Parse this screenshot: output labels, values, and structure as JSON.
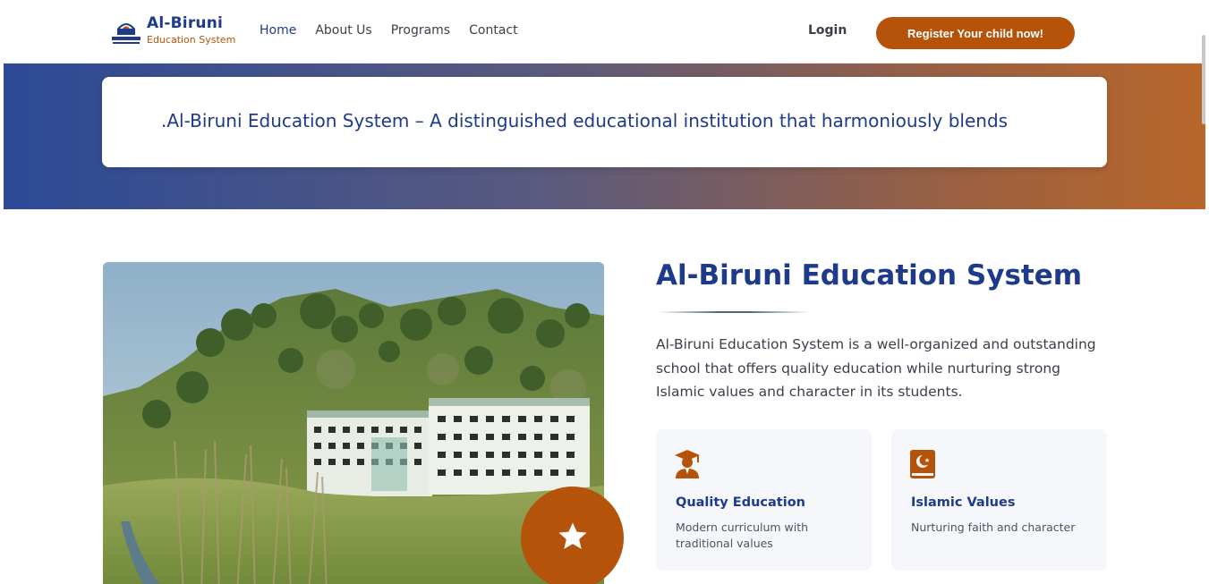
{
  "header": {
    "brand_title": "Al-Biruni",
    "brand_subtitle": "Education System",
    "nav": [
      {
        "label": "Home"
      },
      {
        "label": "About Us"
      },
      {
        "label": "Programs"
      },
      {
        "label": "Contact"
      }
    ],
    "login_label": "Login",
    "register_label": "Register Your child now!"
  },
  "banner": {
    "ticker_text": ".Al-Biruni Education System – A distinguished educational institution that harmoniously blends"
  },
  "about": {
    "title": "Al-Biruni Education System",
    "description": "Al-Biruni Education System is a well-organized and outstanding school that offers quality education while nurturing strong Islamic values and character in its students.",
    "features": [
      {
        "icon": "graduate-icon",
        "title": "Quality Education",
        "desc": "Modern curriculum with traditional values"
      },
      {
        "icon": "quran-book-icon",
        "title": "Islamic Values",
        "desc": "Nurturing faith and character"
      }
    ]
  },
  "colors": {
    "primary": "#1e3a8a",
    "accent": "#b45309",
    "banner_left": "#2c4a96",
    "banner_right": "#b8672a"
  }
}
